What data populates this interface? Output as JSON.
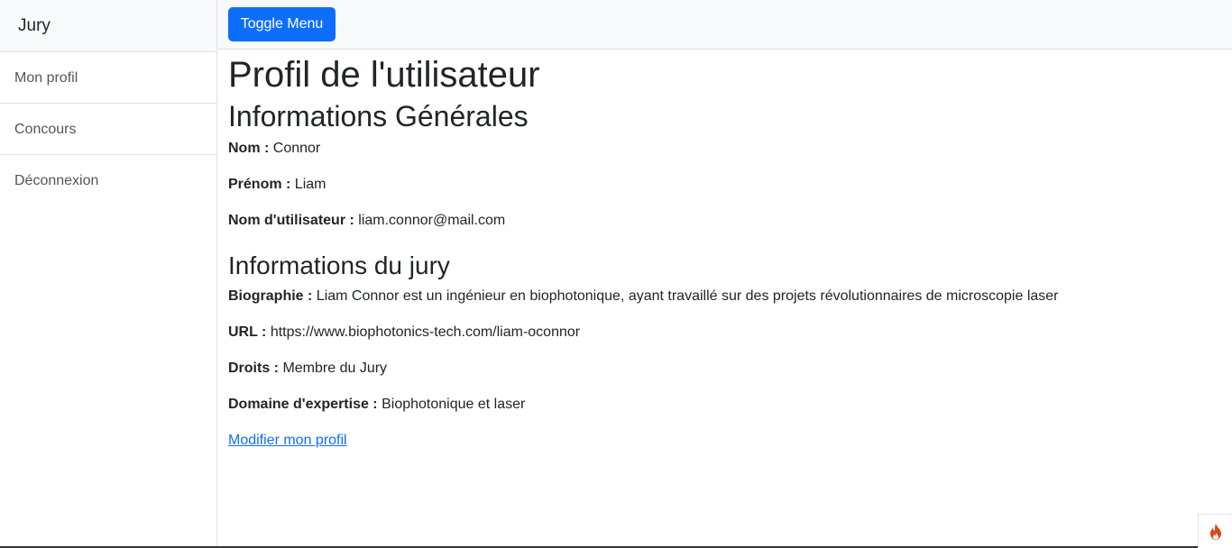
{
  "sidebar": {
    "heading": "Jury",
    "items": [
      {
        "label": "Mon profil"
      },
      {
        "label": "Concours"
      },
      {
        "label": "Déconnexion"
      }
    ]
  },
  "topbar": {
    "toggle_label": "Toggle Menu"
  },
  "page": {
    "title": "Profil de l'utilisateur",
    "general_heading": "Informations Générales",
    "general": [
      {
        "label": "Nom :",
        "value": "Connor"
      },
      {
        "label": "Prénom :",
        "value": "Liam"
      },
      {
        "label": "Nom d'utilisateur :",
        "value": "liam.connor@mail.com"
      }
    ],
    "jury_heading": "Informations du jury",
    "jury": [
      {
        "label": "Biographie :",
        "value": "Liam Connor est un ingénieur en biophotonique, ayant travaillé sur des projets révolutionnaires de microscopie laser"
      },
      {
        "label": "URL :",
        "value": "https://www.biophotonics-tech.com/liam-oconnor"
      },
      {
        "label": "Droits :",
        "value": "Membre du Jury"
      },
      {
        "label": "Domaine d'expertise :",
        "value": "Biophotonique et laser"
      }
    ],
    "edit_link": "Modifier mon profil"
  },
  "colors": {
    "accent": "#0d6efd",
    "badge_flame": "#dd4814"
  },
  "icons": {
    "badge": "flame-icon"
  }
}
